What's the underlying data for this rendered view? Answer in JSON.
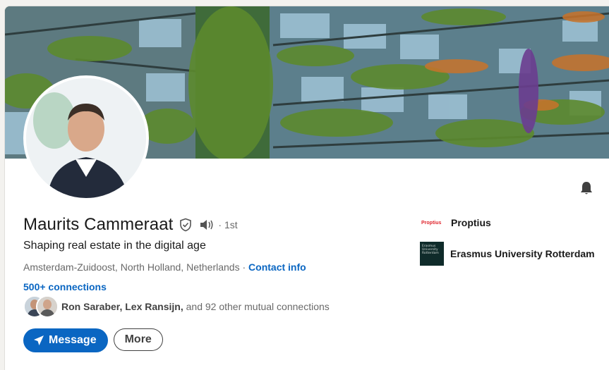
{
  "profile": {
    "name": "Maurits Cammeraat",
    "degree": "· 1st",
    "headline": "Shaping real estate in the digital age",
    "location": "Amsterdam-Zuidoost, North Holland, Netherlands",
    "location_sep": " · ",
    "contact_info": "Contact info",
    "connections": "500+ connections"
  },
  "mutual": {
    "names": "Ron Saraber, Lex Ransijn,",
    "rest": " and 92 other mutual connections"
  },
  "actions": {
    "message_label": "Message",
    "more_label": "More"
  },
  "orgs": [
    {
      "name": "Proptius",
      "logo_text": "Proptius"
    },
    {
      "name": "Erasmus University Rotterdam",
      "logo_text": "Erasmus University Rotterdam"
    }
  ],
  "colors": {
    "accent": "#0a66c2",
    "proptius_red": "#e0262e",
    "erasmus_green": "#0f2b2a"
  },
  "icons": {
    "verified": "shield-check-icon",
    "pronunciation": "speaker-icon",
    "notifications": "bell-icon",
    "message": "send-icon"
  }
}
